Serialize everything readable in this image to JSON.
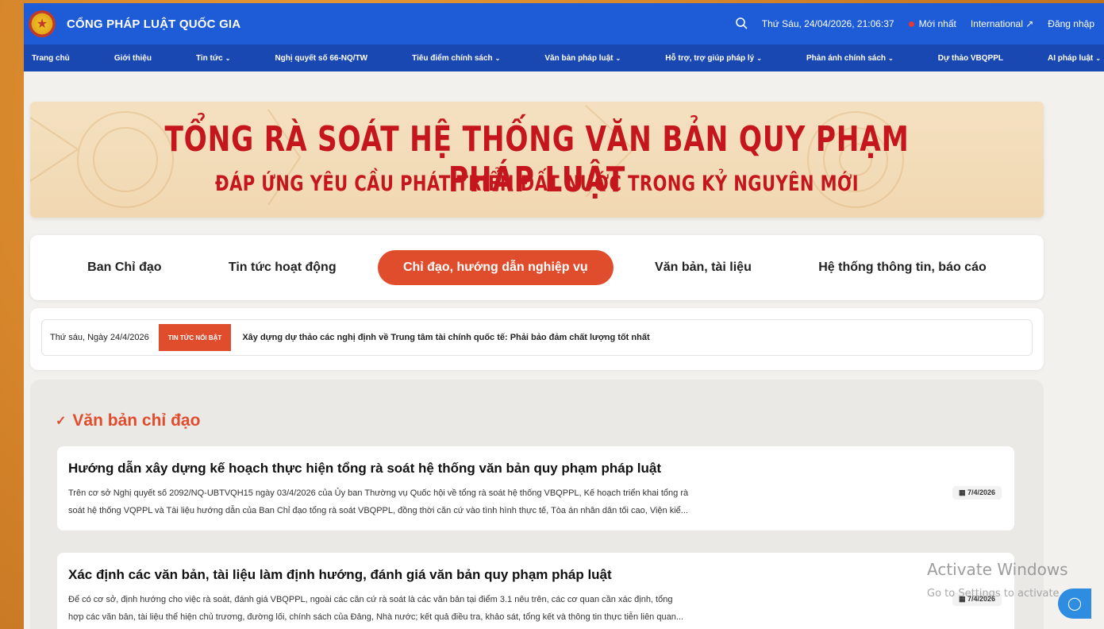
{
  "header": {
    "site_title": "CỔNG PHÁP LUẬT QUỐC GIA",
    "datetime": "Thứ Sáu, 24/04/2026, 21:06:37",
    "latest": "Mới nhất",
    "international": "International ↗",
    "login": "Đăng nhập"
  },
  "nav": {
    "items": [
      {
        "label": "Trang chủ",
        "dropdown": false
      },
      {
        "label": "Giới thiệu",
        "dropdown": false
      },
      {
        "label": "Tin tức",
        "dropdown": true
      },
      {
        "label": "Nghị quyết số 66-NQ/TW",
        "dropdown": false
      },
      {
        "label": "Tiêu điểm chính sách",
        "dropdown": true
      },
      {
        "label": "Văn bản pháp luật",
        "dropdown": true
      },
      {
        "label": "Hỗ trợ, trợ giúp pháp lý",
        "dropdown": true
      },
      {
        "label": "Phản ánh chính sách",
        "dropdown": true
      },
      {
        "label": "Dự thảo VBQPPL",
        "dropdown": false
      },
      {
        "label": "AI pháp luật",
        "dropdown": true
      }
    ]
  },
  "banner": {
    "title": "TỔNG RÀ SOÁT HỆ THỐNG VĂN BẢN QUY PHẠM PHÁP LUẬT",
    "subtitle": "ĐÁP ỨNG YÊU CẦU PHÁT TRIỂN ĐẤT NƯỚC TRONG KỶ NGUYÊN MỚI"
  },
  "tabs": {
    "items": [
      {
        "label": "Ban Chỉ đạo",
        "active": false
      },
      {
        "label": "Tin tức hoạt động",
        "active": false
      },
      {
        "label": "Chỉ đạo, hướng dẫn nghiệp vụ",
        "active": true
      },
      {
        "label": "Văn bản, tài liệu",
        "active": false
      },
      {
        "label": "Hệ thống thông tin, báo cáo",
        "active": false
      }
    ]
  },
  "ticker": {
    "date": "Thứ sáu, Ngày 24/4/2026",
    "badge": "TIN TỨC NỔI BẬT",
    "headline": "Xây dựng dự thảo các nghị định về Trung tâm tài chính quốc tế: Phải bảo đảm chất lượng tốt nhất"
  },
  "main": {
    "section_title": "Văn bản chỉ đạo",
    "articles": [
      {
        "title": "Hướng dẫn xây dựng kế hoạch thực hiện tổng rà soát hệ thống văn bản quy phạm pháp luật",
        "line1": "Trên cơ sở Nghị quyết số 2092/NQ-UBTVQH15 ngày 03/4/2026 của Ủy ban Thường vụ Quốc hội về tổng rà soát hệ thống VBQPPL, Kế hoạch triển khai tổng rà",
        "line2": "soát hệ thống VQPPL và Tài liệu hướng dẫn của Ban Chỉ đạo tổng rà soát VBQPPL, đồng thời căn cứ vào tình hình thực tế, Tòa án nhân dân tối cao, Viện kiể...",
        "date": "7/4/2026"
      },
      {
        "title": "Xác định các văn bản, tài liệu làm định hướng, đánh giá văn bản quy phạm pháp luật",
        "line1": "Để có cơ sở, định hướng cho việc rà soát, đánh giá VBQPPL, ngoài các căn cứ rà soát là các văn bản tại điểm 3.1 nêu trên, các cơ quan cần xác định, tổng",
        "line2": "hợp các văn bản, tài liệu thể hiện chủ trương, đường lối, chính sách của Đảng, Nhà nước; kết quả điều tra, khảo sát, tổng kết và thông tin thực tiễn liên quan...",
        "date": "7/4/2026"
      }
    ]
  },
  "overlay": {
    "watermark_title": "Activate Windows",
    "watermark_sub": "Go to Settings to activate"
  }
}
